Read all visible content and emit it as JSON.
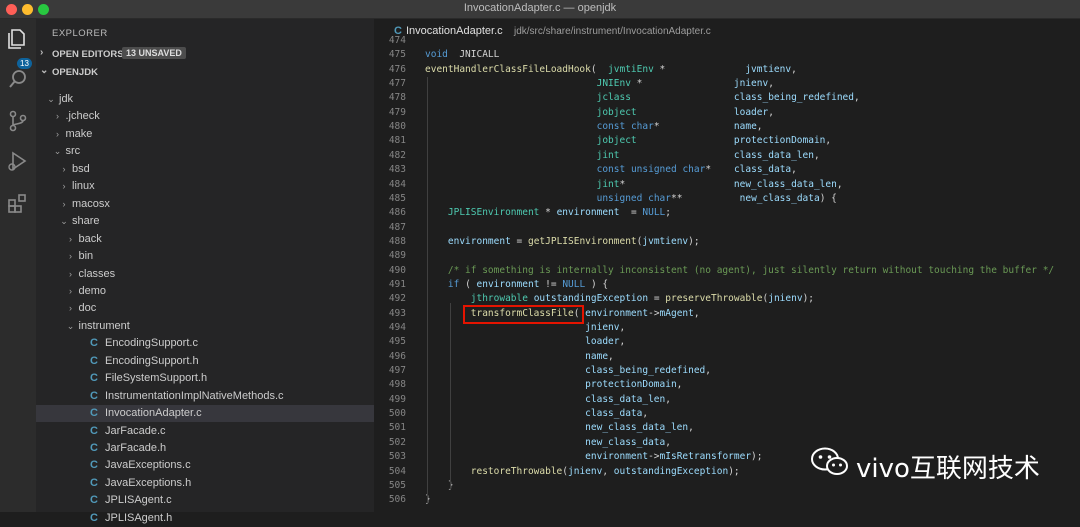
{
  "window": {
    "title": "InvocationAdapter.c — openjdk"
  },
  "activity_bar": {
    "badge_count": "13"
  },
  "sidebar": {
    "title": "EXPLORER",
    "open_editors": {
      "label": "OPEN EDITORS",
      "badge": "13 UNSAVED"
    },
    "project": {
      "label": "OPENJDK"
    },
    "tree": [
      {
        "label": "jdk",
        "type": "folder",
        "expanded": true,
        "depth": 0
      },
      {
        "label": ".jcheck",
        "type": "folder",
        "expanded": false,
        "depth": 1
      },
      {
        "label": "make",
        "type": "folder",
        "expanded": false,
        "depth": 1
      },
      {
        "label": "src",
        "type": "folder",
        "expanded": true,
        "depth": 1
      },
      {
        "label": "bsd",
        "type": "folder",
        "expanded": false,
        "depth": 2
      },
      {
        "label": "linux",
        "type": "folder",
        "expanded": false,
        "depth": 2
      },
      {
        "label": "macosx",
        "type": "folder",
        "expanded": false,
        "depth": 2
      },
      {
        "label": "share",
        "type": "folder",
        "expanded": true,
        "depth": 2
      },
      {
        "label": "back",
        "type": "folder",
        "expanded": false,
        "depth": 3
      },
      {
        "label": "bin",
        "type": "folder",
        "expanded": false,
        "depth": 3
      },
      {
        "label": "classes",
        "type": "folder",
        "expanded": false,
        "depth": 3
      },
      {
        "label": "demo",
        "type": "folder",
        "expanded": false,
        "depth": 3
      },
      {
        "label": "doc",
        "type": "folder",
        "expanded": false,
        "depth": 3
      },
      {
        "label": "instrument",
        "type": "folder",
        "expanded": true,
        "depth": 3
      },
      {
        "label": "EncodingSupport.c",
        "type": "c-file",
        "depth": 4
      },
      {
        "label": "EncodingSupport.h",
        "type": "c-file",
        "depth": 4
      },
      {
        "label": "FileSystemSupport.h",
        "type": "c-file",
        "depth": 4
      },
      {
        "label": "InstrumentationImplNativeMethods.c",
        "type": "c-file",
        "depth": 4
      },
      {
        "label": "InvocationAdapter.c",
        "type": "c-file",
        "depth": 4,
        "selected": true
      },
      {
        "label": "JarFacade.c",
        "type": "c-file",
        "depth": 4
      },
      {
        "label": "JarFacade.h",
        "type": "c-file",
        "depth": 4
      },
      {
        "label": "JavaExceptions.c",
        "type": "c-file",
        "depth": 4
      },
      {
        "label": "JavaExceptions.h",
        "type": "c-file",
        "depth": 4
      },
      {
        "label": "JPLISAgent.c",
        "type": "c-file",
        "depth": 4
      },
      {
        "label": "JPLISAgent.h",
        "type": "c-file",
        "depth": 4
      }
    ]
  },
  "editor": {
    "tab": {
      "icon": "C",
      "name": "InvocationAdapter.c",
      "path": "jdk/src/share/instrument/InvocationAdapter.c"
    },
    "lines": [
      {
        "n": "474",
        "t": []
      },
      {
        "n": "475",
        "t": [
          [
            "kw",
            "void"
          ],
          [
            "",
            "  JNICALL"
          ]
        ]
      },
      {
        "n": "476",
        "t": [
          [
            "fn",
            "eventHandlerClassFileLoadHook"
          ],
          [
            "",
            "(  "
          ],
          [
            "ty",
            "jvmtiEnv"
          ],
          [
            "",
            " *              "
          ],
          [
            "pr",
            "jvmtienv"
          ],
          [
            "",
            ","
          ]
        ]
      },
      {
        "n": "477",
        "t": [
          [
            "",
            "                              "
          ],
          [
            "ty",
            "JNIEnv"
          ],
          [
            "",
            " *                "
          ],
          [
            "pr",
            "jnienv"
          ],
          [
            "",
            ","
          ]
        ]
      },
      {
        "n": "478",
        "t": [
          [
            "",
            "                              "
          ],
          [
            "ty",
            "jclass"
          ],
          [
            "",
            "                  "
          ],
          [
            "pr",
            "class_being_redefined"
          ],
          [
            "",
            ","
          ]
        ]
      },
      {
        "n": "479",
        "t": [
          [
            "",
            "                              "
          ],
          [
            "ty",
            "jobject"
          ],
          [
            "",
            "                 "
          ],
          [
            "pr",
            "loader"
          ],
          [
            "",
            ","
          ]
        ]
      },
      {
        "n": "480",
        "t": [
          [
            "",
            "                              "
          ],
          [
            "kw",
            "const"
          ],
          [
            "",
            " "
          ],
          [
            "kw",
            "char"
          ],
          [
            "",
            "*             "
          ],
          [
            "pr",
            "name"
          ],
          [
            "",
            ","
          ]
        ]
      },
      {
        "n": "481",
        "t": [
          [
            "",
            "                              "
          ],
          [
            "ty",
            "jobject"
          ],
          [
            "",
            "                 "
          ],
          [
            "pr",
            "protectionDomain"
          ],
          [
            "",
            ","
          ]
        ]
      },
      {
        "n": "482",
        "t": [
          [
            "",
            "                              "
          ],
          [
            "ty",
            "jint"
          ],
          [
            "",
            "                    "
          ],
          [
            "pr",
            "class_data_len"
          ],
          [
            "",
            ","
          ]
        ]
      },
      {
        "n": "483",
        "t": [
          [
            "",
            "                              "
          ],
          [
            "kw",
            "const"
          ],
          [
            "",
            " "
          ],
          [
            "kw",
            "unsigned"
          ],
          [
            "",
            " "
          ],
          [
            "kw",
            "char"
          ],
          [
            "",
            "*    "
          ],
          [
            "pr",
            "class_data"
          ],
          [
            "",
            ","
          ]
        ]
      },
      {
        "n": "484",
        "t": [
          [
            "",
            "                              "
          ],
          [
            "ty",
            "jint"
          ],
          [
            "",
            "*                   "
          ],
          [
            "pr",
            "new_class_data_len"
          ],
          [
            "",
            ","
          ]
        ]
      },
      {
        "n": "485",
        "t": [
          [
            "",
            "                              "
          ],
          [
            "kw",
            "unsigned"
          ],
          [
            "",
            " "
          ],
          [
            "kw",
            "char"
          ],
          [
            "",
            "**          "
          ],
          [
            "pr",
            "new_class_data"
          ],
          [
            "",
            ") {"
          ]
        ]
      },
      {
        "n": "486",
        "t": [
          [
            "",
            "    "
          ],
          [
            "ty",
            "JPLISEnvironment"
          ],
          [
            "",
            " * "
          ],
          [
            "pr",
            "environment"
          ],
          [
            "",
            "  = "
          ],
          [
            "kw",
            "NULL"
          ],
          [
            "",
            ";"
          ]
        ]
      },
      {
        "n": "487",
        "t": []
      },
      {
        "n": "488",
        "t": [
          [
            "",
            "    "
          ],
          [
            "pr",
            "environment"
          ],
          [
            "",
            " = "
          ],
          [
            "fn",
            "getJPLISEnvironment"
          ],
          [
            "",
            "("
          ],
          [
            "pr",
            "jvmtienv"
          ],
          [
            "",
            ");"
          ]
        ]
      },
      {
        "n": "489",
        "t": []
      },
      {
        "n": "490",
        "t": [
          [
            "",
            "    "
          ],
          [
            "cm",
            "/* if something is internally inconsistent (no agent), just silently return without touching the buffer */"
          ]
        ]
      },
      {
        "n": "491",
        "t": [
          [
            "",
            "    "
          ],
          [
            "kw",
            "if"
          ],
          [
            "",
            " ( "
          ],
          [
            "pr",
            "environment"
          ],
          [
            "",
            " != "
          ],
          [
            "kw",
            "NULL"
          ],
          [
            "",
            " ) {"
          ]
        ]
      },
      {
        "n": "492",
        "t": [
          [
            "",
            "        "
          ],
          [
            "ty",
            "jthrowable"
          ],
          [
            "",
            " "
          ],
          [
            "pr",
            "outstandingException"
          ],
          [
            "",
            " = "
          ],
          [
            "fn",
            "preserveThrowable"
          ],
          [
            "",
            "("
          ],
          [
            "pr",
            "jnienv"
          ],
          [
            "",
            ");"
          ]
        ]
      },
      {
        "n": "493",
        "t": [
          [
            "",
            "        "
          ],
          [
            "fn",
            "transformClassFile"
          ],
          [
            "",
            "( "
          ],
          [
            "pr",
            "environment"
          ],
          [
            "",
            "->"
          ],
          [
            "pr",
            "mAgent"
          ],
          [
            "",
            ","
          ]
        ]
      },
      {
        "n": "494",
        "t": [
          [
            "",
            "                            "
          ],
          [
            "pr",
            "jnienv"
          ],
          [
            "",
            ","
          ]
        ]
      },
      {
        "n": "495",
        "t": [
          [
            "",
            "                            "
          ],
          [
            "pr",
            "loader"
          ],
          [
            "",
            ","
          ]
        ]
      },
      {
        "n": "496",
        "t": [
          [
            "",
            "                            "
          ],
          [
            "pr",
            "name"
          ],
          [
            "",
            ","
          ]
        ]
      },
      {
        "n": "497",
        "t": [
          [
            "",
            "                            "
          ],
          [
            "pr",
            "class_being_redefined"
          ],
          [
            "",
            ","
          ]
        ]
      },
      {
        "n": "498",
        "t": [
          [
            "",
            "                            "
          ],
          [
            "pr",
            "protectionDomain"
          ],
          [
            "",
            ","
          ]
        ]
      },
      {
        "n": "499",
        "t": [
          [
            "",
            "                            "
          ],
          [
            "pr",
            "class_data_len"
          ],
          [
            "",
            ","
          ]
        ]
      },
      {
        "n": "500",
        "t": [
          [
            "",
            "                            "
          ],
          [
            "pr",
            "class_data"
          ],
          [
            "",
            ","
          ]
        ]
      },
      {
        "n": "501",
        "t": [
          [
            "",
            "                            "
          ],
          [
            "pr",
            "new_class_data_len"
          ],
          [
            "",
            ","
          ]
        ]
      },
      {
        "n": "502",
        "t": [
          [
            "",
            "                            "
          ],
          [
            "pr",
            "new_class_data"
          ],
          [
            "",
            ","
          ]
        ]
      },
      {
        "n": "503",
        "t": [
          [
            "",
            "                            "
          ],
          [
            "pr",
            "environment"
          ],
          [
            "",
            "->"
          ],
          [
            "pr",
            "mIsRetransformer"
          ],
          [
            "",
            ");"
          ]
        ]
      },
      {
        "n": "504",
        "t": [
          [
            "",
            "        "
          ],
          [
            "fn",
            "restoreThrowable"
          ],
          [
            "",
            "("
          ],
          [
            "pr",
            "jnienv"
          ],
          [
            "",
            ", "
          ],
          [
            "pr",
            "outstandingException"
          ],
          [
            "",
            ");"
          ]
        ]
      },
      {
        "n": "505",
        "t": [
          [
            "",
            "    }"
          ]
        ]
      },
      {
        "n": "506",
        "t": [
          [
            "",
            "}"
          ]
        ]
      }
    ]
  },
  "watermark": {
    "text": "vivo互联网技术"
  }
}
